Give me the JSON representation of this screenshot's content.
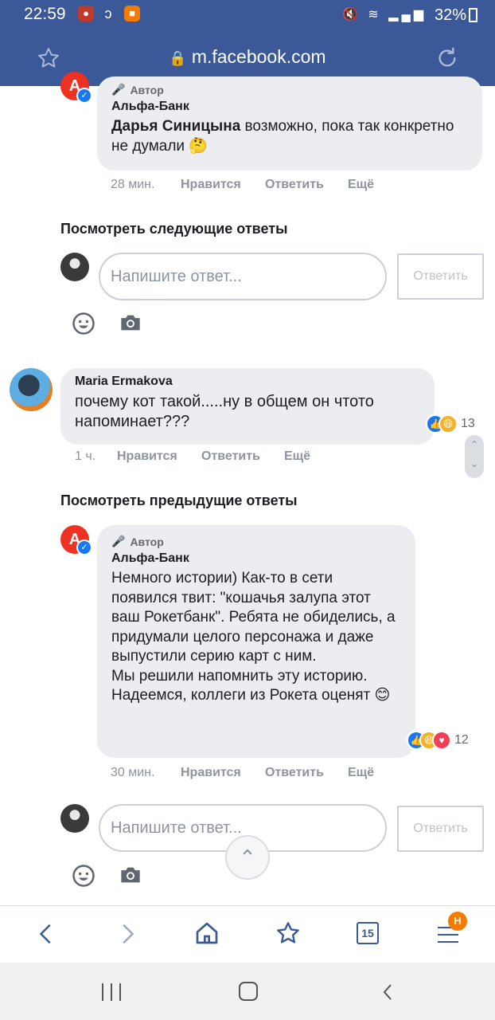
{
  "status_bar": {
    "time": "22:59",
    "battery": "32%"
  },
  "url_bar": {
    "url": "m.facebook.com"
  },
  "comment_top": {
    "author_badge": "Автор",
    "author": "Альфа-Банк",
    "mention": "Дарья Синицына",
    "text": " возможно, пока так конкретно не думали 🤔",
    "time": "28 мин.",
    "like": "Нравится",
    "reply": "Ответить",
    "more": "Ещё"
  },
  "next_replies_link": "Посмотреть следующие ответы",
  "reply_box_1": {
    "placeholder": "Напишите ответ...",
    "button": "Ответить"
  },
  "comment_maria": {
    "author": "Maria Ermakova",
    "text": "почему кот такой.....ну в общем он чтото напоминает???",
    "reactions_count": "13",
    "time": "1 ч.",
    "like": "Нравится",
    "reply": "Ответить",
    "more": "Ещё"
  },
  "prev_replies_link": "Посмотреть предыдущие ответы",
  "comment_bank": {
    "author_badge": "Автор",
    "author": "Альфа-Банк",
    "avatar_letter": "А",
    "text": "Немного истории) Как-то в сети появился твит: \"кошачья залупа этот ваш Рокетбанк\". Ребята не обиделись, а придумали целого персонажа и даже выпустили серию карт с ним.\nМы решили напомнить эту историю. Надеемся, коллеги из Рокета оценят 😊",
    "reactions_count": "12",
    "time": "30 мин.",
    "like": "Нравится",
    "reply": "Ответить",
    "more": "Ещё"
  },
  "reply_box_2": {
    "placeholder": "Напишите ответ...",
    "button": "Ответить"
  },
  "browser_nav": {
    "tabs_count": "15",
    "menu_badge": "Н"
  },
  "colors": {
    "facebook_blue": "#3b5998",
    "alfa_red": "#ef3124",
    "like_blue": "#1877f2"
  }
}
